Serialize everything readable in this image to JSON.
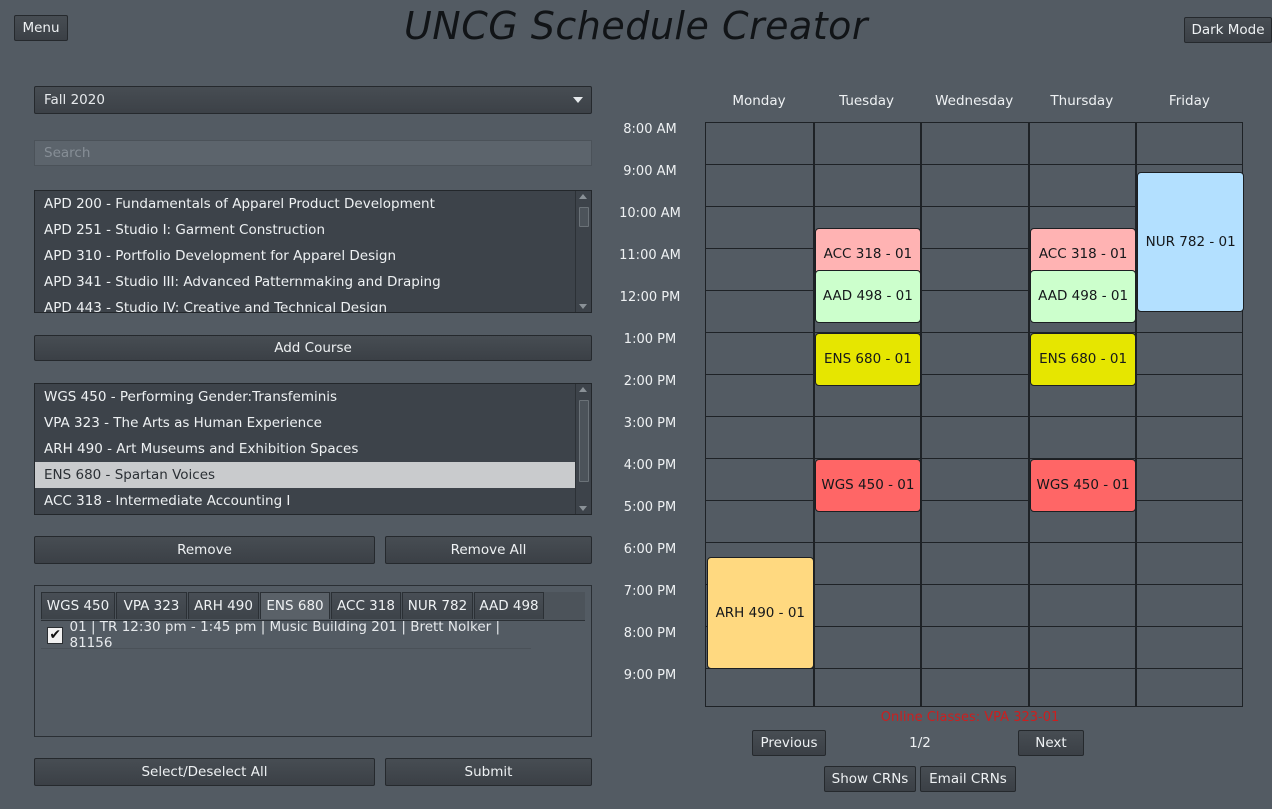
{
  "app": {
    "title": "UNCG Schedule Creator",
    "menu_label": "Menu",
    "dark_mode_label": "Dark Mode"
  },
  "semester": {
    "selected": "Fall 2020"
  },
  "search": {
    "placeholder": "Search"
  },
  "course_list": [
    "APD 200 - Fundamentals of Apparel Product Development",
    "APD 251 - Studio I: Garment Construction",
    "APD 310 - Portfolio Development for Apparel Design",
    "APD 341 - Studio III: Advanced Patternmaking and Draping",
    "APD 443 - Studio IV: Creative and Technical Design"
  ],
  "add_course_label": "Add Course",
  "selected_courses": [
    "WGS 450 - Performing Gender:Transfeminis",
    "VPA 323 - The Arts as Human Experience",
    "ARH 490 - Art Museums and Exhibition Spaces",
    "ENS 680 - Spartan Voices",
    "ACC 318 - Intermediate Accounting I"
  ],
  "selected_index": 3,
  "remove_label": "Remove",
  "remove_all_label": "Remove All",
  "section_tabs": [
    "WGS 450",
    "VPA 323",
    "ARH 490",
    "ENS 680",
    "ACC 318",
    "NUR 782",
    "AAD 498"
  ],
  "active_tab": "ENS 680",
  "sections": [
    {
      "checked": true,
      "text": "01 | TR 12:30 pm - 1:45 pm | Music Building 201 | Brett Nolker | 81156"
    }
  ],
  "select_all_label": "Select/Deselect All",
  "submit_label": "Submit",
  "schedule": {
    "days": [
      "Monday",
      "Tuesday",
      "Wednesday",
      "Thursday",
      "Friday"
    ],
    "times": [
      "8:00 AM",
      "9:00 AM",
      "10:00 AM",
      "11:00 AM",
      "12:00 PM",
      "1:00 PM",
      "2:00 PM",
      "3:00 PM",
      "4:00 PM",
      "5:00 PM",
      "6:00 PM",
      "7:00 PM",
      "8:00 PM",
      "9:00 PM"
    ],
    "blocks": [
      {
        "label": "ACC 318 - 01",
        "day": "Tuesday",
        "start": "10:00 AM",
        "end": "11:15 AM",
        "color": "#ffb3b3"
      },
      {
        "label": "ACC 318 - 01",
        "day": "Thursday",
        "start": "10:00 AM",
        "end": "11:15 AM",
        "color": "#ffb3b3"
      },
      {
        "label": "AAD 498 - 01",
        "day": "Tuesday",
        "start": "11:00 AM",
        "end": "12:15 PM",
        "color": "#ccffcc"
      },
      {
        "label": "AAD 498 - 01",
        "day": "Thursday",
        "start": "11:00 AM",
        "end": "12:15 PM",
        "color": "#ccffcc"
      },
      {
        "label": "ENS 680 - 01",
        "day": "Tuesday",
        "start": "12:30 PM",
        "end": "1:45 PM",
        "color": "#e6e600"
      },
      {
        "label": "ENS 680 - 01",
        "day": "Thursday",
        "start": "12:30 PM",
        "end": "1:45 PM",
        "color": "#e6e600"
      },
      {
        "label": "WGS 450 - 01",
        "day": "Tuesday",
        "start": "3:30 PM",
        "end": "4:45 PM",
        "color": "#ff6666"
      },
      {
        "label": "WGS 450 - 01",
        "day": "Thursday",
        "start": "3:30 PM",
        "end": "4:45 PM",
        "color": "#ff6666"
      },
      {
        "label": "NUR 782 - 01",
        "day": "Friday",
        "start": "8:40 AM",
        "end": "12:00 PM",
        "color": "#b3e0ff"
      },
      {
        "label": "ARH 490 - 01",
        "day": "Monday",
        "start": "5:50 PM",
        "end": "8:30 PM",
        "color": "#ffd980"
      }
    ]
  },
  "online_classes": "Online Classes: VPA 323-01",
  "pagination": {
    "previous_label": "Previous",
    "next_label": "Next",
    "page": "1/2"
  },
  "show_crns_label": "Show CRNs",
  "email_crns_label": "Email CRNs"
}
